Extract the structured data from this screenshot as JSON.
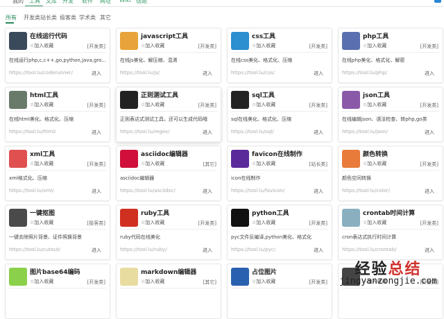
{
  "topnav": [
    "我的",
    "工具",
    "文库",
    "开发",
    "软件",
    "网址",
    "Wiki",
    "话题"
  ],
  "tabs": [
    "所有",
    "开发类",
    "站长类",
    "极客类",
    "学术类",
    "其它"
  ],
  "fav_label": "加入收藏",
  "enter_label": "进入",
  "accent": "#2a8a5a",
  "cards": [
    {
      "title": "在线运行代码",
      "cat": "[开发类]",
      "desc": "在线运行php,c,c++,go,python,java,gro...",
      "url": "https://tool.lu/coderunner/",
      "icon": "code-screen-icon",
      "color": "#3b4a5a"
    },
    {
      "title": "javascript工具",
      "cat": "[开发类]",
      "desc": "在线js美化、解压缩、混淆",
      "url": "https://tool.lu/js/",
      "icon": "js-file-icon",
      "color": "#e8a33a"
    },
    {
      "title": "css工具",
      "cat": "[开发类]",
      "desc": "在线css美化、格式化、压缩",
      "url": "https://tool.lu/css/",
      "icon": "css-file-icon",
      "color": "#2b8fd0"
    },
    {
      "title": "php工具",
      "cat": "[开发类]",
      "desc": "在线php美化、格式化、解密",
      "url": "https://tool.lu/php/",
      "icon": "php-laptop-icon",
      "color": "#5a6fb0"
    },
    {
      "title": "html工具",
      "cat": "[开发类]",
      "desc": "在线html美化、格式化、压缩",
      "url": "https://tool.lu/html/",
      "icon": "html-editor-icon",
      "color": "#6a7a6a"
    },
    {
      "title": "正则测试工具",
      "cat": "[开发类]",
      "desc": "正则表达式测试工具，还可以生成代码哦",
      "url": "https://tool.lu/regex/",
      "icon": "regex-icon",
      "color": "#222222"
    },
    {
      "title": "sql工具",
      "cat": "[开发类]",
      "desc": "sql在线美化、格式化、压缩",
      "url": "https://tool.lu/sql/",
      "icon": "sql-icon",
      "color": "#222222"
    },
    {
      "title": "json工具",
      "cat": "[开发类]",
      "desc": "在线编辑json、语法检查、转php,go类",
      "url": "https://tool.lu/json/",
      "icon": "json-file-icon",
      "color": "#8a5aa8"
    },
    {
      "title": "xml工具",
      "cat": "[开发类]",
      "desc": "xml格式化、压缩",
      "url": "https://tool.lu/xml/",
      "icon": "xml-file-icon",
      "color": "#e05050"
    },
    {
      "title": "asciidoc编辑器",
      "cat": "[其它]",
      "desc": "asciidoc编辑器",
      "url": "https://tool.lu/asciidoc/",
      "icon": "asciidoc-icon",
      "color": "#d0103a"
    },
    {
      "title": "favicon在线制作",
      "cat": "[站长类]",
      "desc": "icon在线制作",
      "url": "https://tool.lu/favicon/",
      "icon": "favicon-icon",
      "color": "#5a2a9a"
    },
    {
      "title": "颜色转换",
      "cat": "[开发类]",
      "desc": "颜色空间转换",
      "url": "https://tool.lu/color/",
      "icon": "color-palette-icon",
      "color": "#e87a3a"
    },
    {
      "title": "一键抠图",
      "cat": "[极客类]",
      "desc": "一键去除照片背景、证件照换背景",
      "url": "https://tool.lu/cutout/",
      "icon": "portrait-icon",
      "color": "#4a4a4a"
    },
    {
      "title": "ruby工具",
      "cat": "[开发类]",
      "desc": "ruby代码在线美化",
      "url": "https://tool.lu/ruby/",
      "icon": "ruby-gem-icon",
      "color": "#d03020"
    },
    {
      "title": "python工具",
      "cat": "[开发类]",
      "desc": "pyc文件反编译,python美化、格式化",
      "url": "https://tool.lu/pyc/",
      "icon": "python-icon",
      "color": "#111111"
    },
    {
      "title": "crontab时间计算",
      "cat": "[开发类]",
      "desc": "cron表达式执行时间计算",
      "url": "https://tool.lu/crontab/",
      "icon": "crontab-icon",
      "color": "#8ab0c0"
    },
    {
      "title": "图片base64编码",
      "cat": "[开发类]",
      "desc": "",
      "url": "",
      "icon": "base64-image-icon",
      "color": "#8ad04a"
    },
    {
      "title": "markdown编辑器",
      "cat": "[其它]",
      "desc": "",
      "url": "",
      "icon": "markdown-notepad-icon",
      "color": "#e8dca0"
    },
    {
      "title": "占位图片",
      "cat": "[开发类]",
      "desc": "",
      "url": "",
      "icon": "placeholder-image-icon",
      "color": "#2a60b0"
    },
    {
      "title": "",
      "cat": "[开发类]",
      "desc": "",
      "url": "",
      "icon": "gear-icon",
      "color": "#444444"
    }
  ],
  "watermark": {
    "line1a": "经验",
    "line1b": "总结",
    "line2": "jingyanzongjie.com"
  }
}
